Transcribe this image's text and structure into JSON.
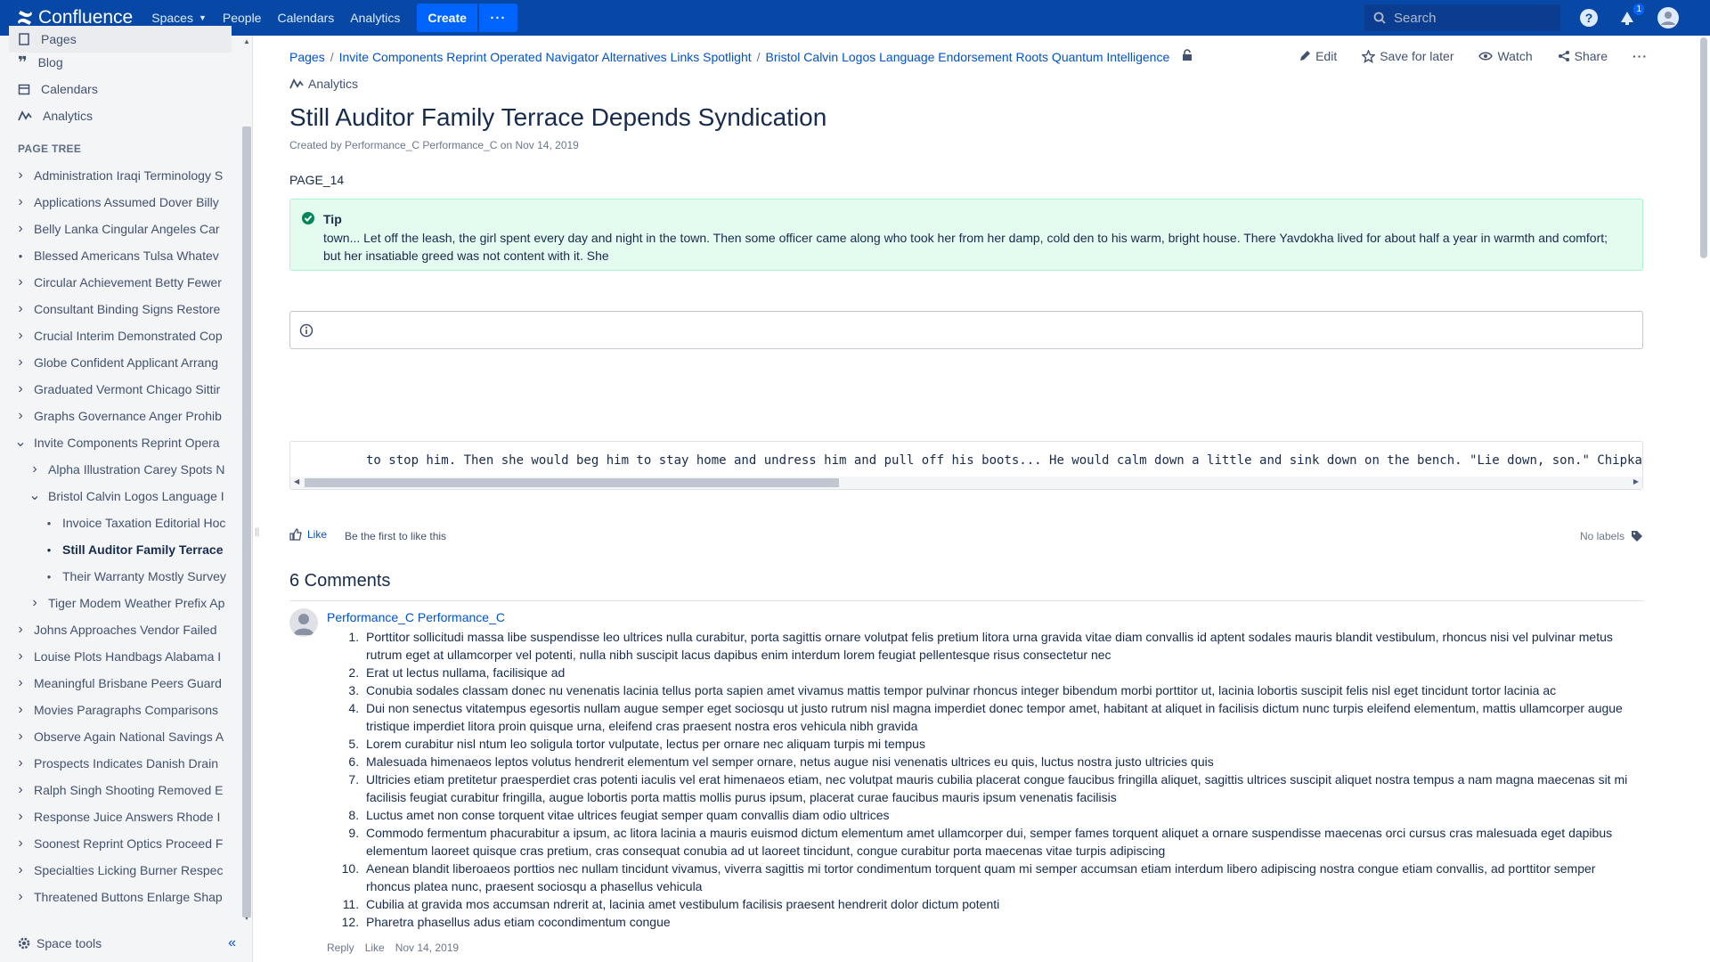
{
  "topnav": {
    "logo": "Confluence",
    "items": [
      "Spaces",
      "People",
      "Calendars",
      "Analytics"
    ],
    "create_label": "Create",
    "more_label": "···",
    "search_placeholder": "Search",
    "notification_count": "1"
  },
  "sidebar": {
    "quick_links": [
      "Pages",
      "Blog",
      "Calendars",
      "Analytics"
    ],
    "pagetree_title": "PAGE TREE",
    "tree": [
      {
        "label": "Administration Iraqi Terminology S",
        "level": 0,
        "type": "collapsed"
      },
      {
        "label": "Applications Assumed Dover Billy",
        "level": 0,
        "type": "collapsed"
      },
      {
        "label": "Belly Lanka Cingular Angeles Car",
        "level": 0,
        "type": "collapsed"
      },
      {
        "label": "Blessed Americans Tulsa Whatev",
        "level": 0,
        "type": "leaf"
      },
      {
        "label": "Circular Achievement Betty Fewer",
        "level": 0,
        "type": "collapsed"
      },
      {
        "label": "Consultant Binding Signs Restore",
        "level": 0,
        "type": "collapsed"
      },
      {
        "label": "Crucial Interim Demonstrated Cop",
        "level": 0,
        "type": "collapsed"
      },
      {
        "label": "Globe Confident Applicant Arrang",
        "level": 0,
        "type": "collapsed"
      },
      {
        "label": "Graduated Vermont Chicago Sittir",
        "level": 0,
        "type": "collapsed"
      },
      {
        "label": "Graphs Governance Anger Prohib",
        "level": 0,
        "type": "collapsed"
      },
      {
        "label": "Invite Components Reprint Opera",
        "level": 0,
        "type": "expanded"
      },
      {
        "label": "Alpha Illustration Carey Spots N",
        "level": 1,
        "type": "collapsed"
      },
      {
        "label": "Bristol Calvin Logos Language I",
        "level": 1,
        "type": "expanded"
      },
      {
        "label": "Invoice Taxation Editorial Hoc",
        "level": 2,
        "type": "leaf"
      },
      {
        "label": "Still Auditor Family Terrace",
        "level": 2,
        "type": "current"
      },
      {
        "label": "Their Warranty Mostly Survey",
        "level": 2,
        "type": "leaf"
      },
      {
        "label": "Tiger Modem Weather Prefix Ap",
        "level": 1,
        "type": "collapsed"
      },
      {
        "label": "Johns Approaches Vendor Failed",
        "level": 0,
        "type": "collapsed"
      },
      {
        "label": "Louise Plots Handbags Alabama I",
        "level": 0,
        "type": "collapsed"
      },
      {
        "label": "Meaningful Brisbane Peers Guard",
        "level": 0,
        "type": "collapsed"
      },
      {
        "label": "Movies Paragraphs Comparisons",
        "level": 0,
        "type": "collapsed"
      },
      {
        "label": "Observe Again National Savings A",
        "level": 0,
        "type": "collapsed"
      },
      {
        "label": "Prospects Indicates Danish Drain",
        "level": 0,
        "type": "collapsed"
      },
      {
        "label": "Ralph Singh Shooting Removed E",
        "level": 0,
        "type": "collapsed"
      },
      {
        "label": "Response Juice Answers Rhode I",
        "level": 0,
        "type": "collapsed"
      },
      {
        "label": "Soonest Reprint Optics Proceed F",
        "level": 0,
        "type": "collapsed"
      },
      {
        "label": "Specialties Licking Burner Respec",
        "level": 0,
        "type": "collapsed"
      },
      {
        "label": "Threatened Buttons Enlarge Shap",
        "level": 0,
        "type": "collapsed"
      }
    ],
    "footer": "Space tools",
    "collapse_icon": "«"
  },
  "breadcrumbs": [
    "Pages",
    "Invite Components Reprint Operated Navigator Alternatives Links Spotlight",
    "Bristol Calvin Logos Language Endorsement Roots Quantum Intelligence"
  ],
  "page_actions": {
    "edit": "Edit",
    "save": "Save for later",
    "watch": "Watch",
    "share": "Share"
  },
  "analytics_label": "Analytics",
  "page": {
    "title": "Still Auditor Family Terrace Depends Syndication",
    "byline": "Created by Performance_C Performance_C on Nov 14, 2019",
    "page_id": "PAGE_14",
    "tip_title": "Tip",
    "tip_body": "town... Let off the leash, the girl spent every day and night in the town. Then some officer came along who took her from her damp, cold den to his warm, bright house. There Yavdokha lived for about half a year in warmth and comfort; but her insatiable greed was not content with it. She",
    "code_line": "to stop him. Then she would beg him to stay home and undress him and pull off his boots... He would calm down a little and sink down on the bench. \"Lie down, son.\" Chipka"
  },
  "likes": {
    "like_label": "Like",
    "first_like": "Be the first to like this",
    "no_labels": "No labels"
  },
  "comments": {
    "title": "6 Comments",
    "author": "Performance_C Performance_C",
    "items": [
      "Porttitor sollicitudi massa libe suspendisse leo ultrices nulla curabitur, porta sagittis ornare volutpat felis pretium litora urna gravida vitae diam convallis id aptent sodales mauris blandit vestibulum, rhoncus nisi vel pulvinar metus rutrum eget at ullamcorper vel potenti, nulla nibh suscipit lacus dapibus enim interdum lorem feugiat pellentesque risus consectetur nec",
      "Erat ut lectus nullama, facilisique ad",
      "Conubia sodales classam donec nu venenatis lacinia tellus porta sapien amet vivamus mattis tempor pulvinar rhoncus integer bibendum morbi porttitor ut, lacinia lobortis suscipit felis nisl eget tincidunt tortor lacinia ac",
      "Dui non senectus vitatempus egesortis nullam augue semper eget sociosqu ut justo rutrum nisl magna imperdiet donec tempor amet, habitant at aliquet in facilisis dictum nunc turpis eleifend elementum, mattis ullamcorper augue tristique imperdiet litora proin quisque urna, eleifend cras praesent nostra eros vehicula nibh gravida",
      "Lorem curabitur nisl ntum leo soligula tortor vulputate, lectus per ornare nec aliquam turpis mi tempus",
      "Malesuada himenaeos leptos volutus hendrerit elementum vel semper ornare, netus augue nisi venenatis ultrices eu quis, luctus nostra justo ultricies quis",
      "Ultricies etiam pretitetur praesperdiet cras potenti iaculis vel erat himenaeos etiam, nec volutpat mauris cubilia placerat congue faucibus fringilla aliquet, sagittis ultrices suscipit aliquet nostra tempus a nam magna maecenas sit mi facilisis feugiat curabitur fringilla, augue lobortis porta mattis mollis purus ipsum, placerat curae faucibus mauris ipsum venenatis facilisis",
      "Luctus amet non conse torquent vitae ultrices feugiat semper quam convallis diam odio ultrices",
      "Commodo fermentum phacurabitur a ipsum, ac litora lacinia a mauris euismod dictum elementum amet ullamcorper dui, semper fames torquent aliquet a ornare suspendisse maecenas orci cursus cras malesuada eget dapibus elementum laoreet quisque cras pretium, cras consequat conubia ad ut laoreet tincidunt, congue curabitur porta maecenas vitae turpis adipiscing",
      "Aenean blandit liberoaeos porttios nec nullam tincidunt vivamus, viverra sagittis mi tortor condimentum torquent quam mi semper accumsan etiam interdum libero adipiscing nostra congue etiam convallis, ad porttitor semper rhoncus platea nunc, praesent sociosqu a phasellus vehicula",
      "Cubilia at gravida mos accumsan ndrerit at, lacinia amet vestibulum facilisis praesent hendrerit dolor dictum potenti",
      "Pharetra phasellus adus etiam cocondimentum congue"
    ],
    "reply_label": "Reply",
    "like_label": "Like",
    "date": "Nov 14, 2019"
  },
  "colors": {
    "topnav_bg": "#0747a6",
    "link": "#0052cc",
    "tip_bg": "#e3fcef",
    "tip_icon": "#00875a"
  }
}
